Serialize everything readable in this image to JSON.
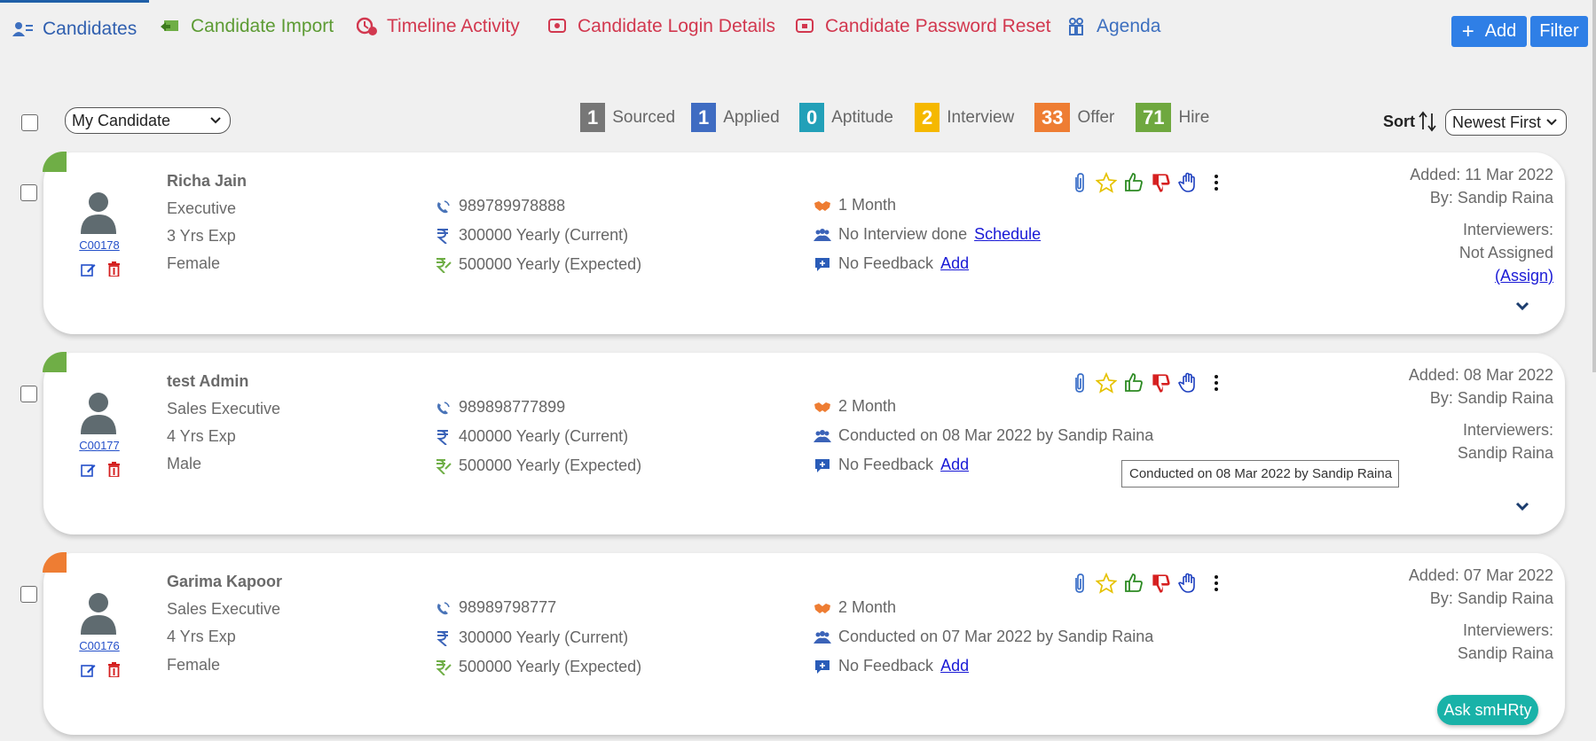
{
  "nav": {
    "tabs": [
      {
        "label": "Candidates"
      },
      {
        "label": "Candidate Import"
      },
      {
        "label": "Timeline Activity"
      },
      {
        "label": "Candidate Login Details"
      },
      {
        "label": "Candidate Password Reset"
      },
      {
        "label": "Agenda"
      }
    ],
    "add_label": "Add",
    "filter_label": "Filter"
  },
  "filters": {
    "owner_select": "My Candidate",
    "sort_label": "Sort",
    "sort_select": "Newest First"
  },
  "stages": [
    {
      "count": "1",
      "label": "Sourced",
      "color": "#777777"
    },
    {
      "count": "1",
      "label": "Applied",
      "color": "#3f6cc2"
    },
    {
      "count": "0",
      "label": "Aptitude",
      "color": "#22a0b8"
    },
    {
      "count": "2",
      "label": "Interview",
      "color": "#f5b800"
    },
    {
      "count": "33",
      "label": "Offer",
      "color": "#ee7d33"
    },
    {
      "count": "71",
      "label": "Hire",
      "color": "#6fa83f"
    }
  ],
  "candidates": [
    {
      "name": "Richa Jain",
      "role": "Executive",
      "experience": "3 Yrs Exp",
      "gender": "Female",
      "code": "C00178",
      "phone": "989789978888",
      "current_ctc": "300000 Yearly (Current)",
      "expected_ctc": "500000 Yearly (Expected)",
      "notice": "1 Month",
      "interview": "No Interview done",
      "interview_link": "Schedule",
      "feedback": "No Feedback",
      "feedback_link": "Add",
      "added": "Added: 11 Mar 2022",
      "by": "By: Sandip Raina",
      "interviewers_label": "Interviewers:",
      "interviewers": "Not Assigned",
      "assign_link": "(Assign)",
      "corner_color": "#6fae46"
    },
    {
      "name": "test Admin",
      "role": "Sales Executive",
      "experience": "4 Yrs Exp",
      "gender": "Male",
      "code": "C00177",
      "phone": "989898777899",
      "current_ctc": "400000 Yearly (Current)",
      "expected_ctc": "500000 Yearly (Expected)",
      "notice": "2 Month",
      "interview": "Conducted on 08 Mar 2022 by Sandip Raina",
      "interview_link": "",
      "feedback": "No Feedback",
      "feedback_link": "Add",
      "added": "Added: 08 Mar 2022",
      "by": "By: Sandip Raina",
      "interviewers_label": "Interviewers:",
      "interviewers": "Sandip Raina",
      "assign_link": "",
      "corner_color": "#6fae46"
    },
    {
      "name": "Garima Kapoor",
      "role": "Sales Executive",
      "experience": "4 Yrs Exp",
      "gender": "Female",
      "code": "C00176",
      "phone": "98989798777",
      "current_ctc": "300000 Yearly (Current)",
      "expected_ctc": "500000 Yearly (Expected)",
      "notice": "2 Month",
      "interview": "Conducted on 07 Mar 2022 by Sandip Raina",
      "interview_link": "",
      "feedback": "No Feedback",
      "feedback_link": "Add",
      "added": "Added: 07 Mar 2022",
      "by": "By: Sandip Raina",
      "interviewers_label": "Interviewers:",
      "interviewers": "Sandip Raina",
      "assign_link": "",
      "corner_color": "#ee7d33"
    }
  ],
  "tooltip": "Conducted on 08 Mar 2022 by Sandip Raina",
  "chat_button": "Ask smHRty"
}
